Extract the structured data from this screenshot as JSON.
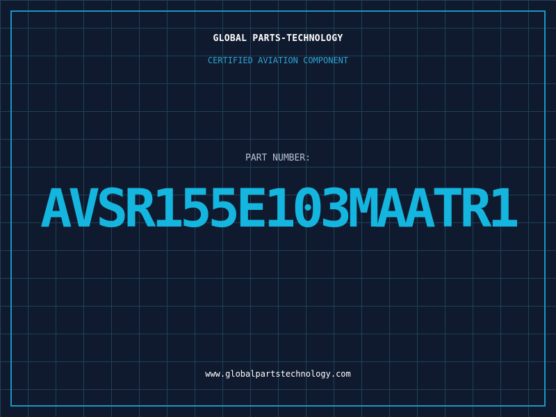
{
  "header": {
    "brand": "GLOBAL PARTS-TECHNOLOGY",
    "subtitle": "CERTIFIED AVIATION COMPONENT"
  },
  "part": {
    "label": "PART NUMBER:",
    "number": "AVSR155E103MAATR1"
  },
  "footer": {
    "website": "www.globalpartstechnology.com"
  },
  "colors": {
    "background": "#101a2e",
    "grid": "#1f4258",
    "frame": "#1b97c4",
    "accent": "#14b6e0",
    "text": "#ffffff"
  }
}
